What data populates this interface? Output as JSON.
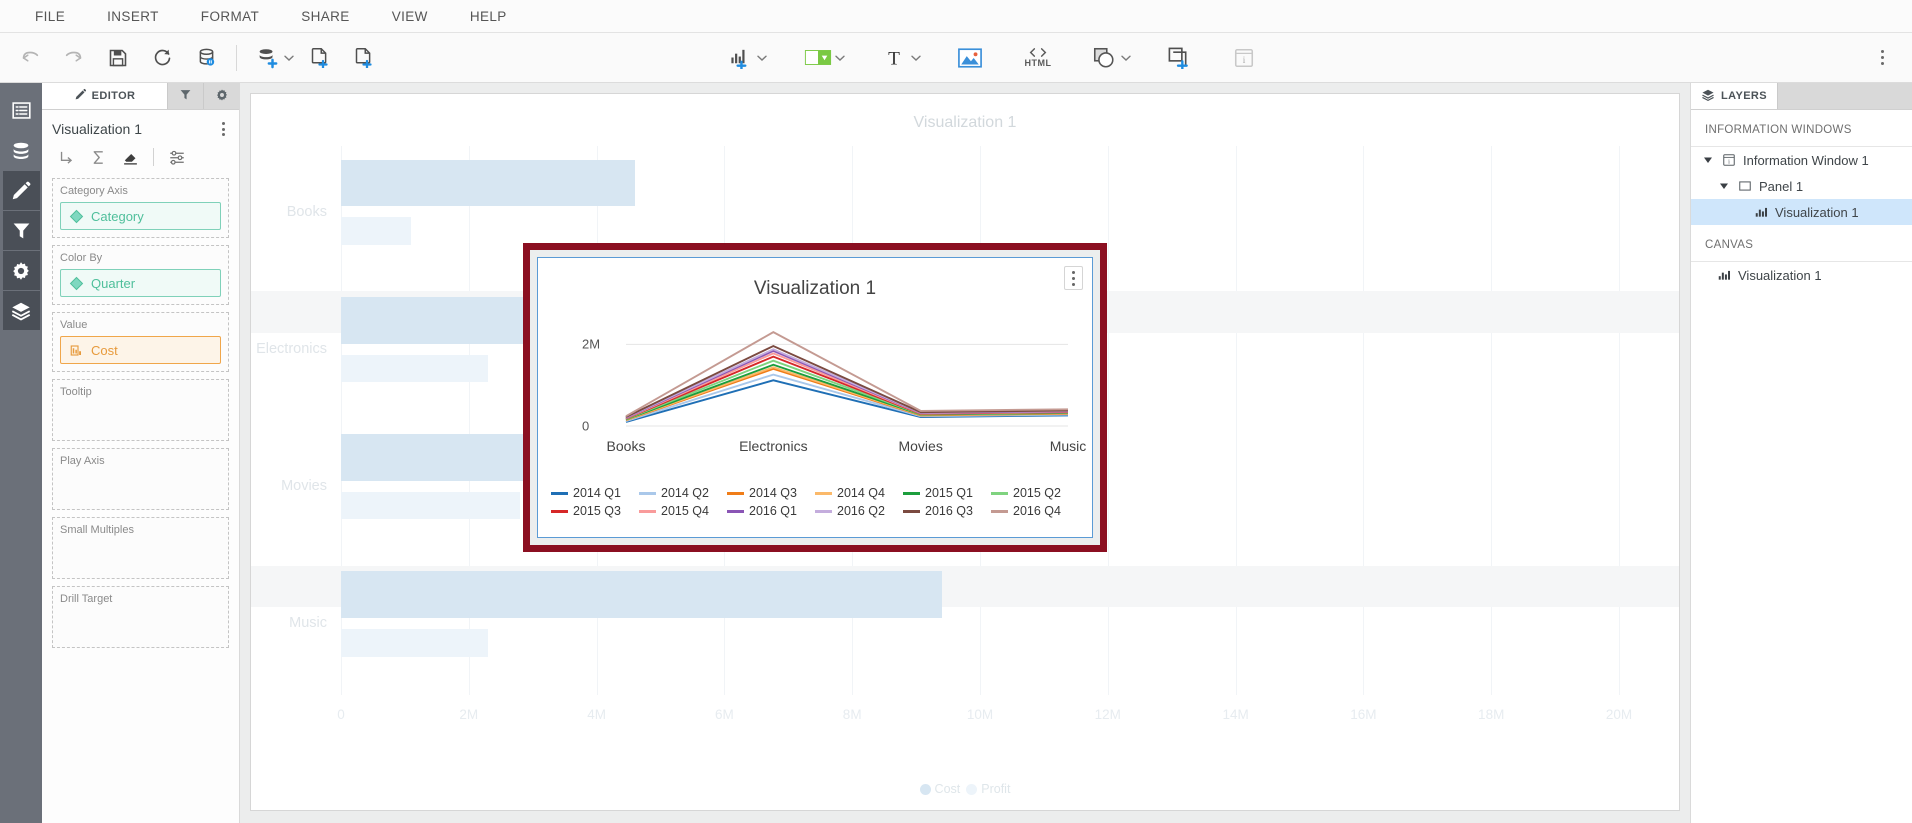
{
  "menubar": {
    "items": [
      "FILE",
      "INSERT",
      "FORMAT",
      "SHARE",
      "VIEW",
      "HELP"
    ]
  },
  "toolbar": {
    "undo": "undo-icon",
    "redo": "redo-icon",
    "save": "save-icon",
    "refresh": "refresh-icon",
    "data_source": "data-source-icon",
    "add_data": "add-data-icon",
    "new_page": "new-page-icon",
    "duplicate_page": "duplicate-page-icon",
    "add_visualization": "add-visualization-icon",
    "color": "color-fill-icon",
    "text": "text-icon",
    "image": "image-icon",
    "html_label": "HTML",
    "shapes": "shapes-icon",
    "add_panel": "add-panel-icon",
    "info_window": "info-window-icon",
    "overflow": "overflow-menu-icon"
  },
  "rail": {
    "items": [
      {
        "name": "pages-icon",
        "active": false
      },
      {
        "name": "data-icon",
        "active": false
      },
      {
        "name": "edit-icon",
        "active": true
      },
      {
        "name": "filter-icon",
        "active": true
      },
      {
        "name": "settings-icon",
        "active": true
      },
      {
        "name": "layers-icon",
        "active": true
      }
    ]
  },
  "editor": {
    "tabs": [
      {
        "label": "EDITOR",
        "icon": "pencil-icon",
        "active": true
      },
      {
        "label": "",
        "icon": "filter-icon",
        "active": false
      },
      {
        "label": "",
        "icon": "gear-icon",
        "active": false
      }
    ],
    "title": "Visualization 1",
    "tools": [
      "branch-icon",
      "sigma-icon",
      "eraser-icon",
      "sliders-icon"
    ],
    "shelves": [
      {
        "label": "Category Axis",
        "value": "Category",
        "kind": "green",
        "icon": "diamond-icon"
      },
      {
        "label": "Color By",
        "value": "Quarter",
        "kind": "green",
        "icon": "diamond-icon"
      },
      {
        "label": "Value",
        "value": "Cost",
        "kind": "orange",
        "icon": "measure-icon"
      },
      {
        "label": "Tooltip",
        "value": "",
        "kind": "empty",
        "icon": ""
      },
      {
        "label": "Play Axis",
        "value": "",
        "kind": "empty",
        "icon": ""
      },
      {
        "label": "Small Multiples",
        "value": "",
        "kind": "empty",
        "icon": ""
      },
      {
        "label": "Drill Target",
        "value": "",
        "kind": "empty",
        "icon": ""
      }
    ]
  },
  "layers": {
    "tab_label": "LAYERS",
    "tab_icon": "layers-icon",
    "section_information_windows": "INFORMATION WINDOWS",
    "section_canvas": "CANVAS",
    "tree": [
      {
        "label": "Information Window 1",
        "icon": "info-window-icon",
        "indent": 0,
        "expanded": true,
        "selected": false
      },
      {
        "label": "Panel 1",
        "icon": "panel-icon",
        "indent": 1,
        "expanded": true,
        "selected": false
      },
      {
        "label": "Visualization 1",
        "icon": "chart-icon",
        "indent": 2,
        "expanded": null,
        "selected": true
      }
    ],
    "canvas_items": [
      {
        "label": "Visualization 1",
        "icon": "chart-icon"
      }
    ]
  },
  "background_chart": {
    "title": "Visualization 1",
    "chart_data": {
      "type": "bar",
      "orientation": "horizontal",
      "title": "Visualization 1",
      "categories": [
        "Books",
        "Electronics",
        "Movies",
        "Music"
      ],
      "series": [
        {
          "name": "Cost",
          "color": "#d7e6f2",
          "values": [
            4.6,
            9.3,
            11.6,
            9.4
          ]
        },
        {
          "name": "Profit",
          "color": "#edf4fa",
          "values": [
            1.1,
            2.3,
            2.8,
            2.3
          ]
        }
      ],
      "xlabel": "",
      "ylabel": "",
      "xticks": [
        "0",
        "2M",
        "4M",
        "6M",
        "8M",
        "10M",
        "12M",
        "14M",
        "16M",
        "18M",
        "20M"
      ],
      "xlim": [
        0,
        20
      ],
      "legend": [
        "Cost",
        "Profit"
      ],
      "legend_position": "bottom",
      "grid": true
    }
  },
  "popup": {
    "title": "Visualization 1",
    "kebab": "overflow-menu-icon",
    "border_color": "#8b0f21",
    "chart_data": {
      "type": "line",
      "title": "Visualization 1",
      "categories": [
        "Books",
        "Electronics",
        "Movies",
        "Music"
      ],
      "xlabel": "",
      "ylabel": "",
      "yticks": [
        "0",
        "2M"
      ],
      "ylim": [
        0,
        2.45
      ],
      "grid": true,
      "legend_position": "bottom",
      "series": [
        {
          "name": "2014 Q1",
          "color": "#1f6fb5",
          "values": [
            0.1,
            1.12,
            0.22,
            0.26
          ]
        },
        {
          "name": "2014 Q2",
          "color": "#aac8ea",
          "values": [
            0.12,
            1.26,
            0.24,
            0.28
          ]
        },
        {
          "name": "2014 Q3",
          "color": "#f07d18",
          "values": [
            0.14,
            1.4,
            0.26,
            0.3
          ]
        },
        {
          "name": "2014 Q4",
          "color": "#fbb96a",
          "values": [
            0.15,
            1.44,
            0.27,
            0.31
          ]
        },
        {
          "name": "2015 Q1",
          "color": "#1c9e3d",
          "values": [
            0.16,
            1.5,
            0.28,
            0.32
          ]
        },
        {
          "name": "2015 Q2",
          "color": "#7fd37f",
          "values": [
            0.17,
            1.6,
            0.29,
            0.33
          ]
        },
        {
          "name": "2015 Q3",
          "color": "#d62728",
          "values": [
            0.18,
            1.7,
            0.3,
            0.34
          ]
        },
        {
          "name": "2015 Q4",
          "color": "#f99b9b",
          "values": [
            0.19,
            1.78,
            0.31,
            0.35
          ]
        },
        {
          "name": "2016 Q1",
          "color": "#8a55b5",
          "values": [
            0.2,
            1.84,
            0.32,
            0.36
          ]
        },
        {
          "name": "2016 Q2",
          "color": "#c4addd",
          "values": [
            0.21,
            1.88,
            0.33,
            0.37
          ]
        },
        {
          "name": "2016 Q3",
          "color": "#7b4a40",
          "values": [
            0.22,
            1.96,
            0.34,
            0.38
          ]
        },
        {
          "name": "2016 Q4",
          "color": "#c49a92",
          "values": [
            0.24,
            2.3,
            0.37,
            0.41
          ]
        }
      ]
    }
  }
}
